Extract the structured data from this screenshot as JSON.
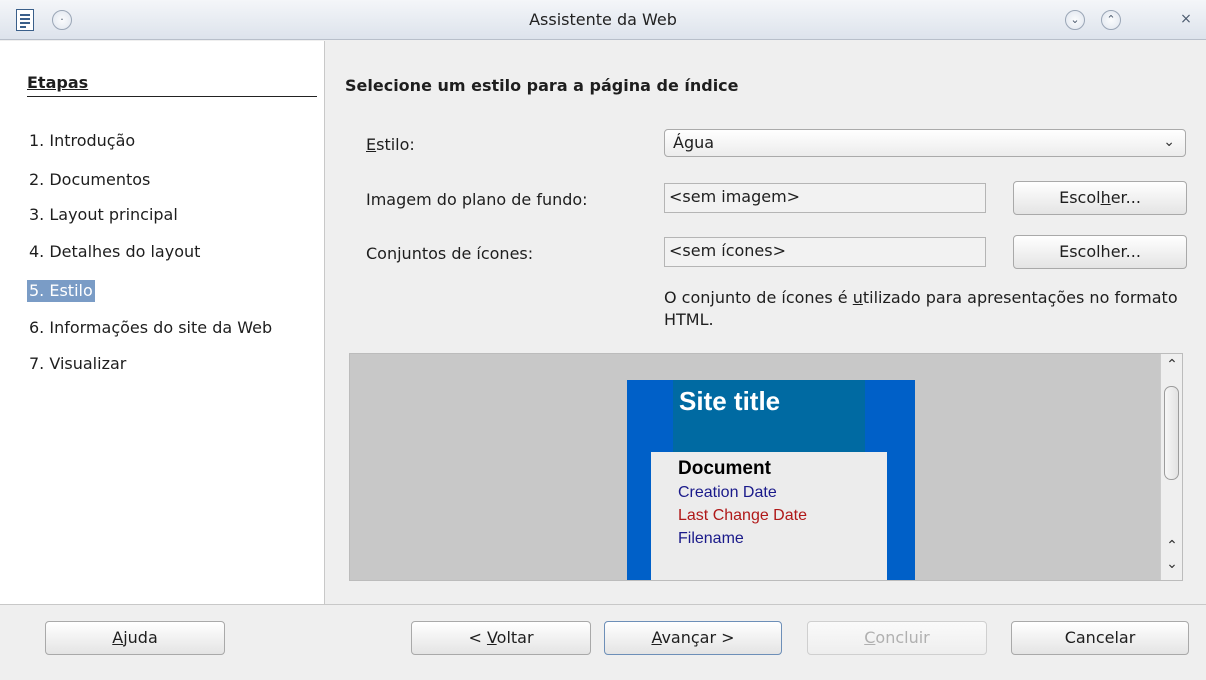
{
  "window": {
    "title": "Assistente da Web"
  },
  "sidebar": {
    "title": "Etapas",
    "steps": [
      {
        "label": "1. Introdução"
      },
      {
        "label": "2. Documentos"
      },
      {
        "label": "3. Layout principal"
      },
      {
        "label": "4. Detalhes do layout"
      },
      {
        "label": "5. Estilo",
        "selected": true
      },
      {
        "label": "6. Informações do site da Web"
      },
      {
        "label": "7. Visualizar"
      }
    ]
  },
  "main": {
    "heading": "Selecione um estilo para a página de índice",
    "style": {
      "label_pre": "",
      "label_mnemonic": "E",
      "label_post": "stilo:",
      "value": "Água"
    },
    "background": {
      "label": "Imagem do plano de fundo:",
      "value": "<sem imagem>",
      "button_pre": "Escol",
      "button_mnemonic": "h",
      "button_post": "er..."
    },
    "icons": {
      "label": "Conjuntos de ícones:",
      "value": "<sem ícones>",
      "button": "Escolher..."
    },
    "note_pre": "O conjunto de ícones é ",
    "note_mnemonic": "u",
    "note_post": "tilizado para apresentações no formato HTML.",
    "preview": {
      "site_title": "Site title",
      "document": "Document",
      "creation_date": "Creation Date",
      "last_change_date": "Last Change Date",
      "filename": "Filename",
      "colors": {
        "page_bg": "#0060c8",
        "header_bg": "#006aa2",
        "body_bg": "#ececec",
        "creation_color": "#1a1a8a",
        "last_change_color": "#b01818",
        "filename_color": "#1a1a8a"
      }
    }
  },
  "footer": {
    "help_mnemonic": "A",
    "help_rest": "juda",
    "back_pre": "< ",
    "back_mnemonic": "V",
    "back_post": "oltar",
    "next_mnemonic": "A",
    "next_post": "vançar >",
    "finish_mnemonic": "C",
    "finish_post": "oncluir",
    "cancel": "Cancelar"
  }
}
